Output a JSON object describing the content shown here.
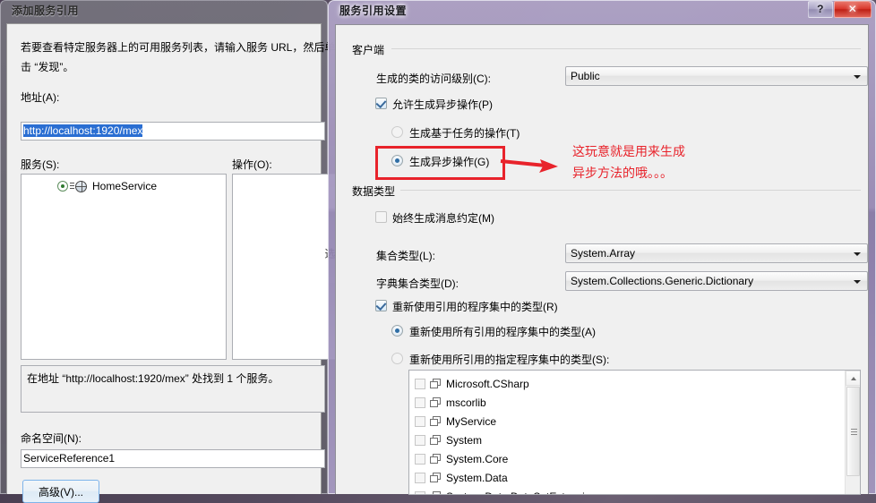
{
  "colors": {
    "accent_red": "#e8232b",
    "selection_blue": "#2a6ed2",
    "active_caption": "#a89cc4",
    "inactive_caption": "#787680"
  },
  "add_service_dialog": {
    "title": "添加服务引用",
    "instruction_line1": "若要查看特定服务器上的可用服务列表，请输入服务 URL，然后单",
    "instruction_line2": "击 “发现”。",
    "address_label": "地址(A):",
    "address_value": "http://localhost:1920/mex",
    "services_label": "服务(S):",
    "operations_label": "操作(O):",
    "service_tree": [
      {
        "name": "HomeService",
        "icon": "globe-icon"
      }
    ],
    "status_text": "在地址 “http://localhost:1920/mex” 处找到 1 个服务。",
    "namespace_label": "命名空间(N):",
    "namespace_value": "ServiceReference1",
    "advanced_button": "高级(V)..."
  },
  "settings_dialog": {
    "title": "服务引用设置",
    "caption_buttons": {
      "help": "?",
      "close": "✕"
    },
    "client_group": {
      "legend": "客户端",
      "access_level_label": "生成的类的访问级别(C):",
      "access_level_value": "Public",
      "allow_async_label": "允许生成异步操作(P)",
      "allow_async_checked": true,
      "task_based_label": "生成基于任务的操作(T)",
      "task_based_selected": false,
      "async_label": "生成异步操作(G)",
      "async_selected": true
    },
    "data_type_group": {
      "legend": "数据类型",
      "always_message_contracts_label": "始终生成消息约定(M)",
      "always_message_contracts_checked": false,
      "collection_type_label": "集合类型(L):",
      "collection_type_value": "System.Array",
      "dictionary_type_label": "字典集合类型(D):",
      "dictionary_type_value": "System.Collections.Generic.Dictionary",
      "reuse_types_label": "重新使用引用的程序集中的类型(R)",
      "reuse_types_checked": true,
      "reuse_all_label": "重新使用所有引用的程序集中的类型(A)",
      "reuse_all_selected": true,
      "reuse_specified_label": "重新使用所引用的指定程序集中的类型(S):",
      "reuse_specified_selected": false,
      "assemblies": [
        {
          "name": "Microsoft.CSharp",
          "checked": false
        },
        {
          "name": "mscorlib",
          "checked": false
        },
        {
          "name": "MyService",
          "checked": false
        },
        {
          "name": "System",
          "checked": false
        },
        {
          "name": "System.Core",
          "checked": false
        },
        {
          "name": "System.Data",
          "checked": false
        },
        {
          "name": "System.Data.DataSetExtensions",
          "checked": false
        }
      ]
    }
  },
  "annotation": {
    "line1": "这玩意就是用来生成",
    "line2": "异步方法的哦。。。"
  }
}
